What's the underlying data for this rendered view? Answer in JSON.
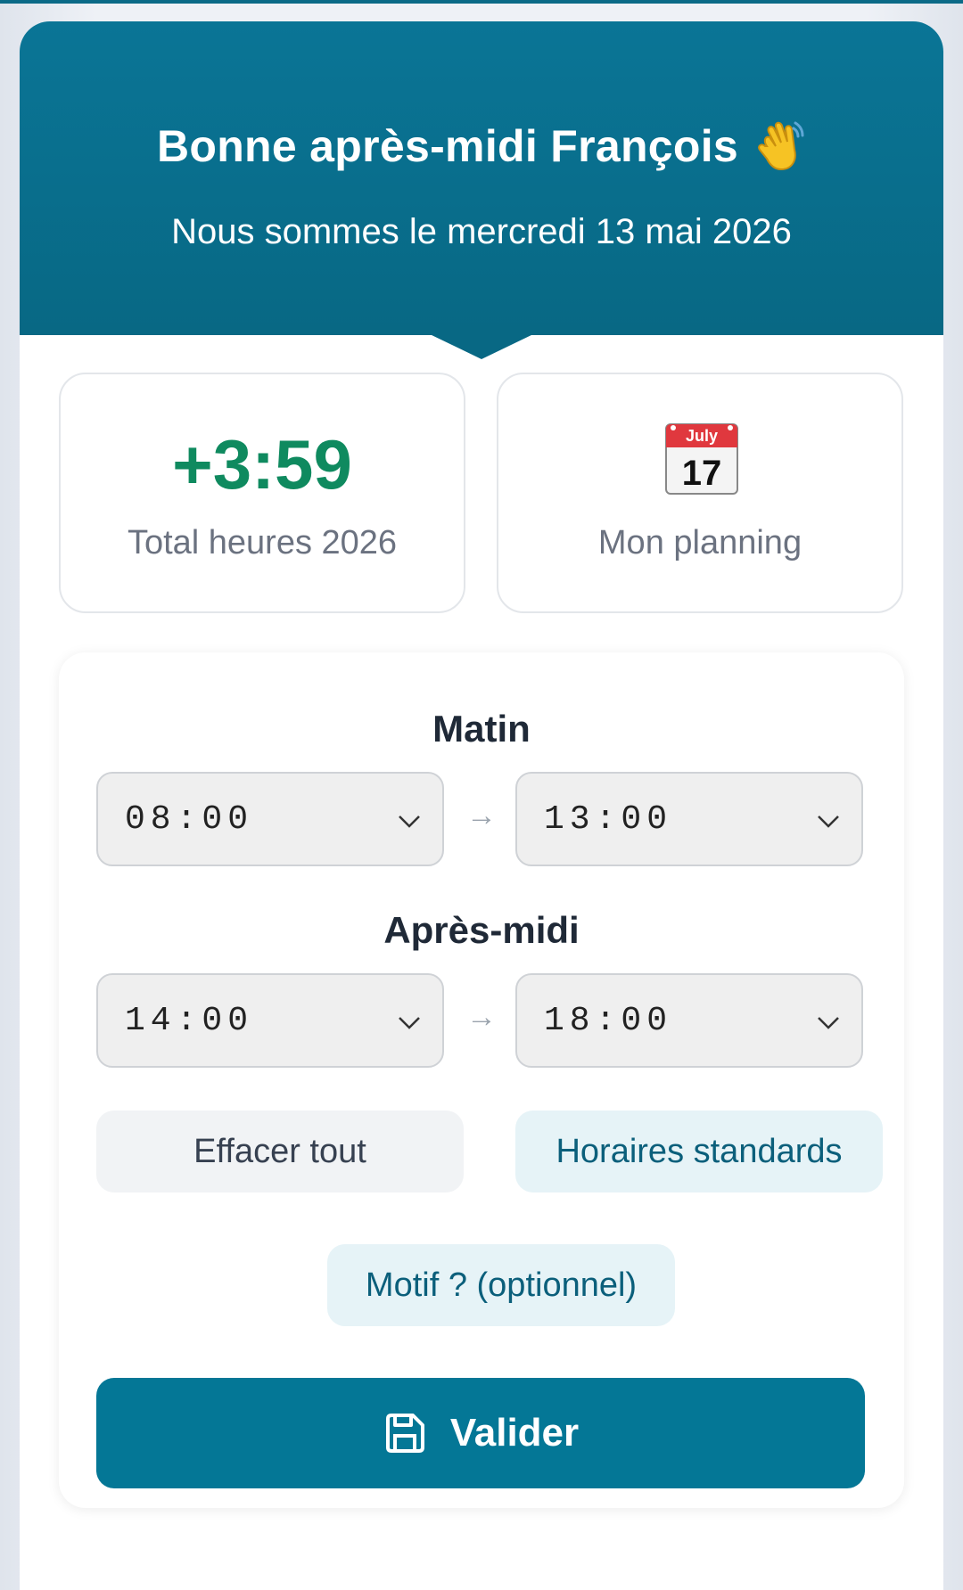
{
  "header": {
    "greeting": "Bonne après-midi François",
    "date_line": "Nous sommes le mercredi 13 mai 2026"
  },
  "stats": {
    "total_value": "+3:59",
    "total_label": "Total heures 2026",
    "calendar_month": "July",
    "calendar_day": "17",
    "planning_label": "Mon planning"
  },
  "form": {
    "morning_title": "Matin",
    "morning_start": "08:00",
    "morning_end": "13:00",
    "afternoon_title": "Après-midi",
    "afternoon_start": "14:00",
    "afternoon_end": "18:00",
    "arrow": "→",
    "clear_label": "Effacer tout",
    "standard_label": "Horaires standards",
    "motif_label": "Motif ? (optionnel)",
    "submit_label": "Valider"
  },
  "colors": {
    "header": "#086884",
    "accent": "#047796",
    "positive": "#0f8a5f"
  },
  "icons": {
    "greeting": "waving-hand-icon",
    "planning": "calendar-icon",
    "select": "chevron-down-icon",
    "submit": "save-icon"
  }
}
